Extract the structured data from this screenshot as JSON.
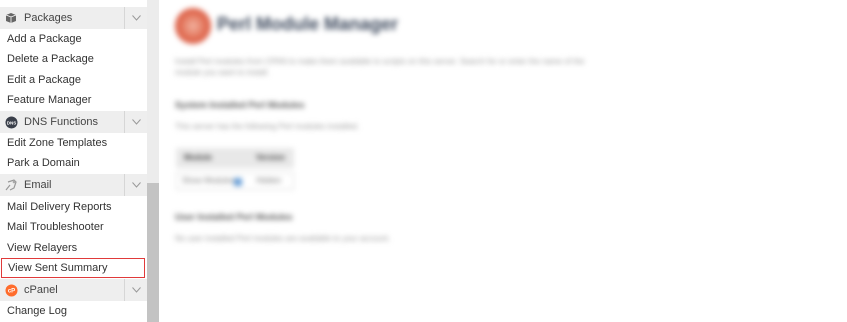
{
  "sidebar": {
    "sections": [
      {
        "title": "Packages",
        "icon": "package-icon",
        "items": [
          "Add a Package",
          "Delete a Package",
          "Edit a Package",
          "Feature Manager"
        ]
      },
      {
        "title": "DNS Functions",
        "icon": "dns-icon",
        "items": [
          "Edit Zone Templates",
          "Park a Domain"
        ]
      },
      {
        "title": "Email",
        "icon": "email-icon",
        "items": [
          "Mail Delivery Reports",
          "Mail Troubleshooter",
          "View Relayers",
          "View Sent Summary"
        ]
      },
      {
        "title": "cPanel",
        "icon": "cpanel-icon",
        "items": [
          "Change Log"
        ]
      }
    ],
    "selected_item": "View Sent Summary",
    "toggle_glyph": "∨"
  },
  "content": {
    "title": "Perl Module Manager",
    "intro": "Install Perl modules from CPAN to make them available to scripts on this server. Search for or enter the name of the module you want to install.",
    "installed_heading": "System Installed Perl Modules",
    "installed_text": "This server has the following Perl modules installed.",
    "table": {
      "headers": [
        "Module",
        "Version"
      ],
      "row": [
        "Show Modules",
        "Hidden"
      ]
    },
    "user_heading": "User Installed Perl Modules",
    "user_text": "No user installed Perl modules are available to your account."
  },
  "colors": {
    "selected_border": "#e03a3a",
    "header_bg": "#eeeeee",
    "cpanel_orange": "#ff6c2c"
  }
}
